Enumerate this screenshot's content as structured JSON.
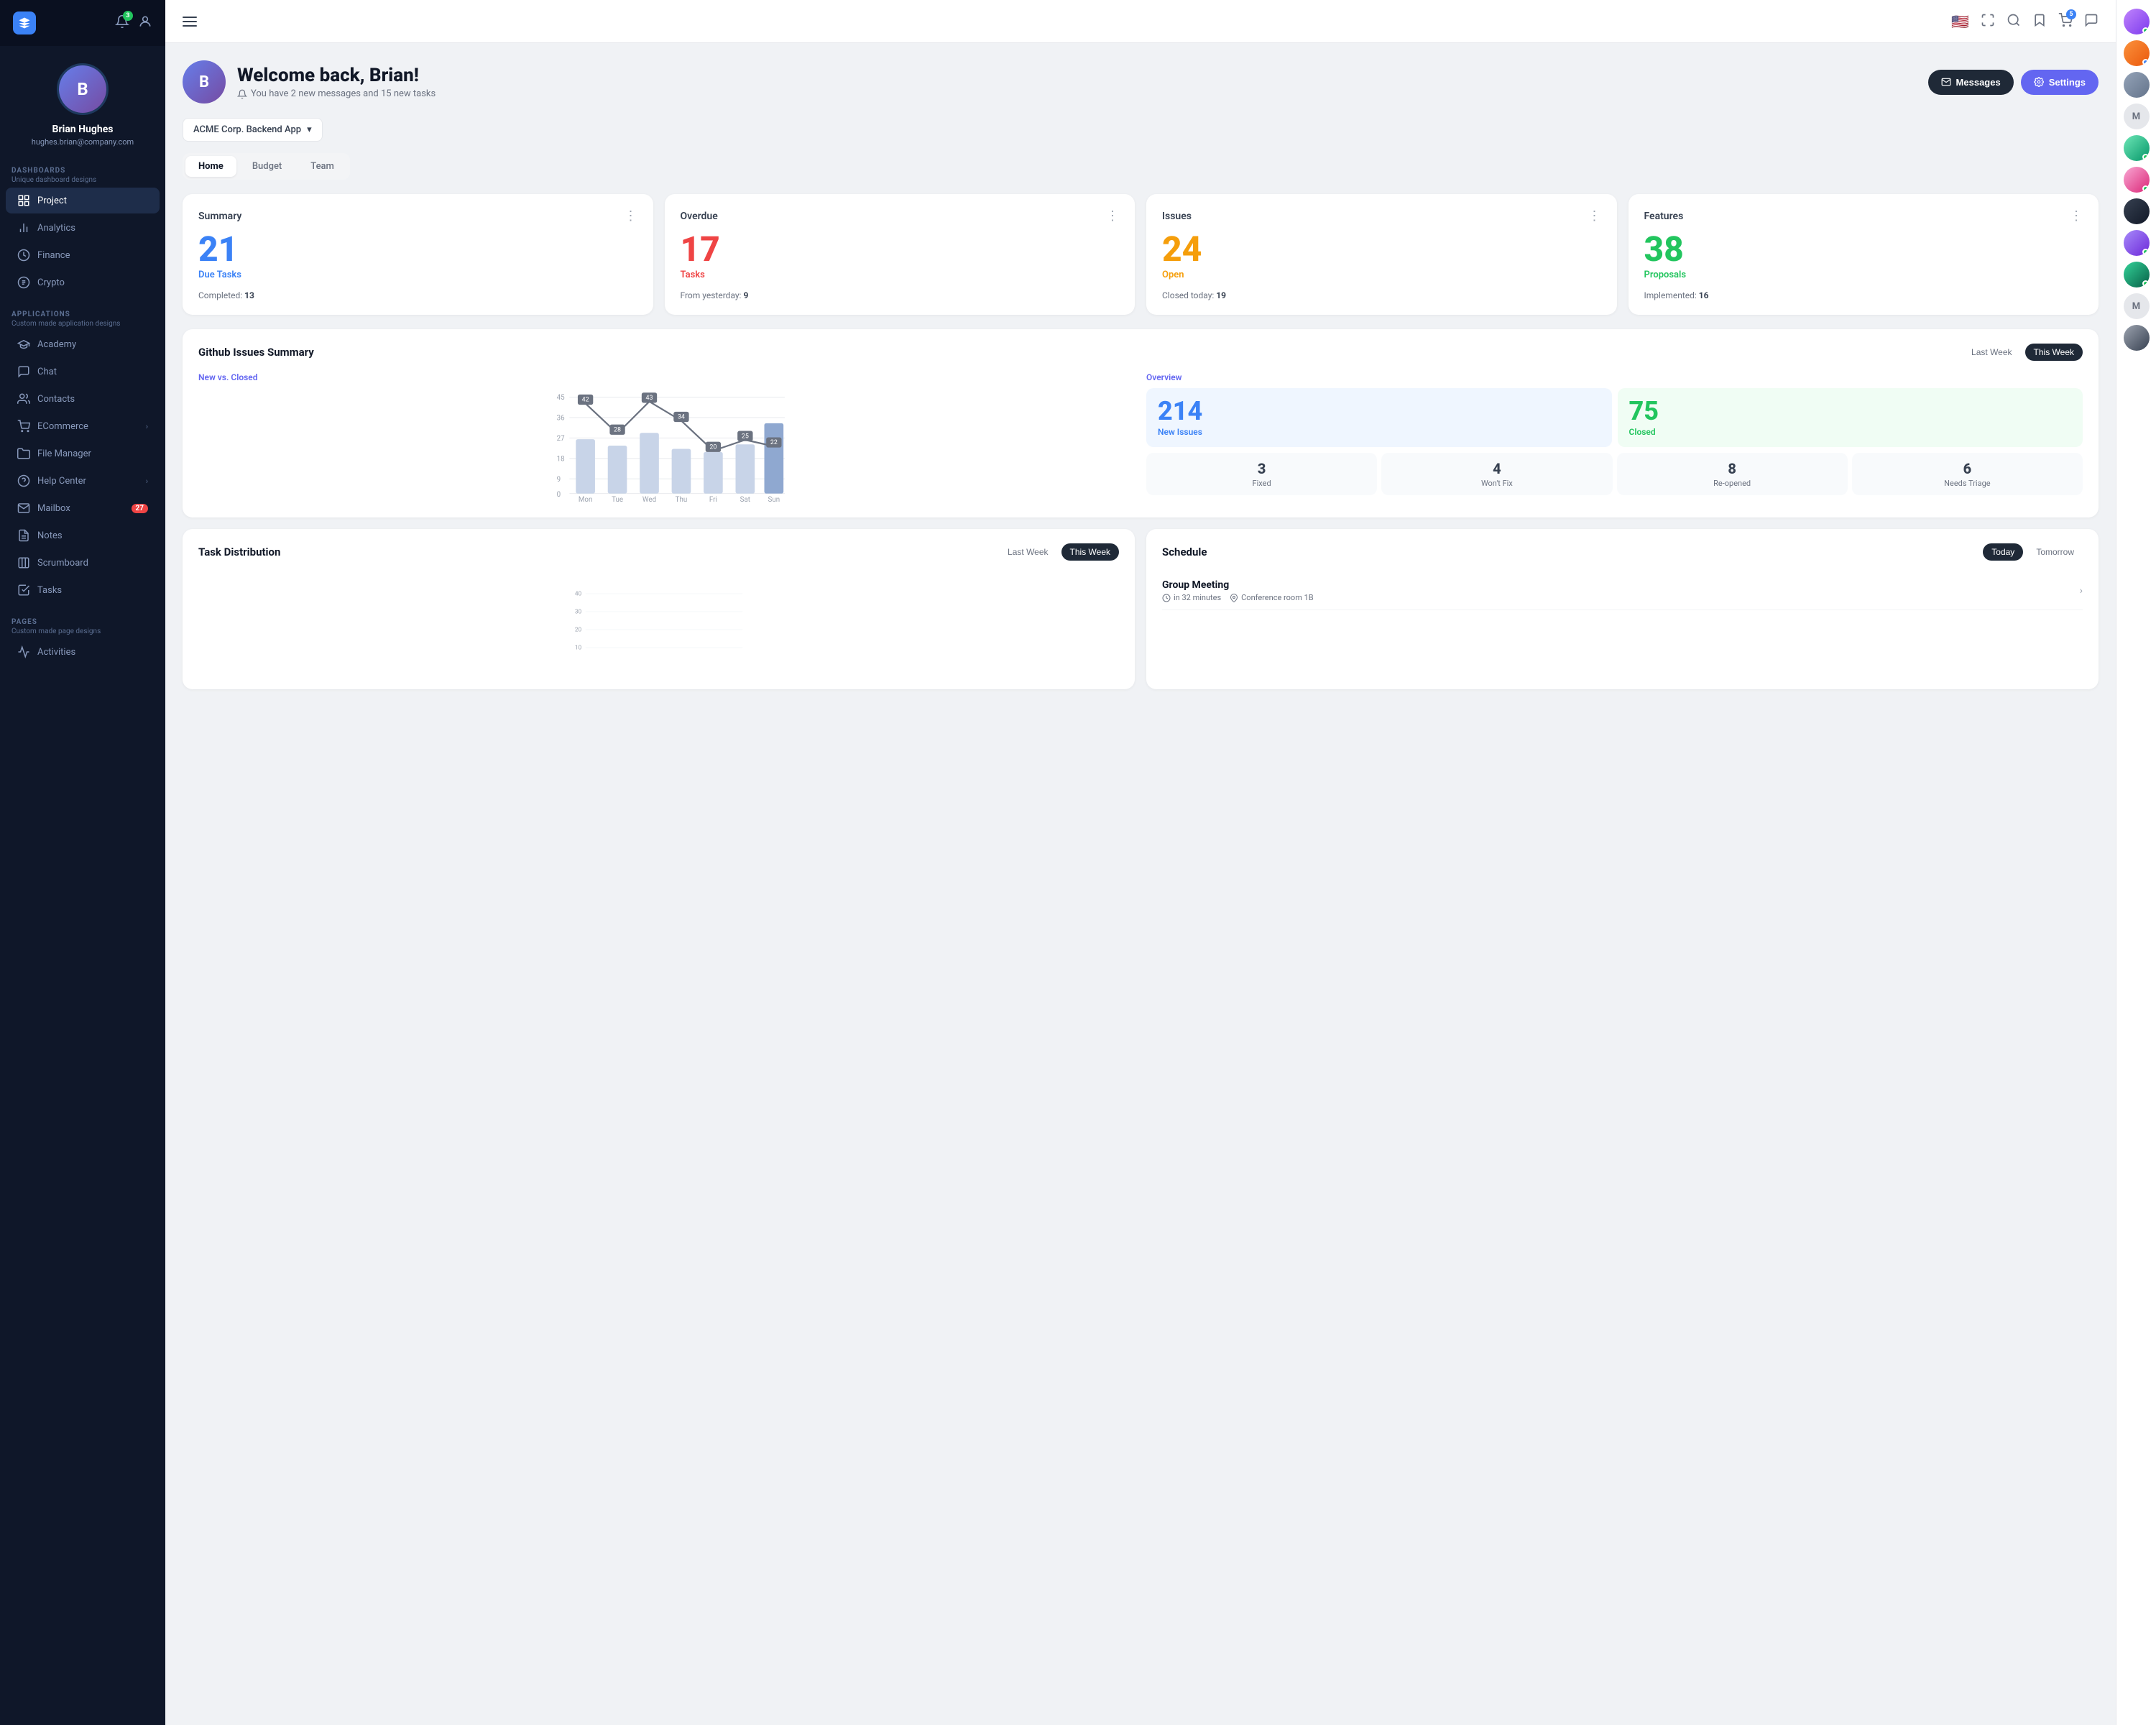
{
  "sidebar": {
    "logo": "◆",
    "notif_count": "3",
    "user": {
      "name": "Brian Hughes",
      "email": "hughes.brian@company.com"
    },
    "dashboards_label": "DASHBOARDS",
    "dashboards_sub": "Unique dashboard designs",
    "dashboards_items": [
      {
        "id": "project",
        "label": "Project",
        "icon": "grid",
        "active": true
      },
      {
        "id": "analytics",
        "label": "Analytics",
        "icon": "chart"
      },
      {
        "id": "finance",
        "label": "Finance",
        "icon": "finance"
      },
      {
        "id": "crypto",
        "label": "Crypto",
        "icon": "crypto"
      }
    ],
    "applications_label": "APPLICATIONS",
    "applications_sub": "Custom made application designs",
    "applications_items": [
      {
        "id": "academy",
        "label": "Academy",
        "icon": "academy"
      },
      {
        "id": "chat",
        "label": "Chat",
        "icon": "chat"
      },
      {
        "id": "contacts",
        "label": "Contacts",
        "icon": "contacts"
      },
      {
        "id": "ecommerce",
        "label": "ECommerce",
        "icon": "ecommerce",
        "arrow": "›"
      },
      {
        "id": "filemanager",
        "label": "File Manager",
        "icon": "file"
      },
      {
        "id": "helpcenter",
        "label": "Help Center",
        "icon": "help",
        "arrow": "›"
      },
      {
        "id": "mailbox",
        "label": "Mailbox",
        "icon": "mail",
        "badge": "27"
      },
      {
        "id": "notes",
        "label": "Notes",
        "icon": "notes"
      },
      {
        "id": "scrumboard",
        "label": "Scrumboard",
        "icon": "scrum"
      },
      {
        "id": "tasks",
        "label": "Tasks",
        "icon": "tasks"
      }
    ],
    "pages_label": "PAGES",
    "pages_sub": "Custom made page designs",
    "pages_items": [
      {
        "id": "activities",
        "label": "Activities",
        "icon": "activity"
      }
    ]
  },
  "topbar": {
    "menu_icon": "☰",
    "flag": "🇺🇸",
    "fullscreen_icon": "⛶",
    "search_icon": "🔍",
    "bookmark_icon": "🔖",
    "cart_icon": "🛒",
    "cart_badge": "5",
    "messages_icon": "💬"
  },
  "welcome": {
    "greeting": "Welcome back, Brian!",
    "subtitle": "You have 2 new messages and 15 new tasks",
    "messages_btn": "Messages",
    "settings_btn": "Settings"
  },
  "project_selector": {
    "label": "ACME Corp. Backend App",
    "arrow": "▾"
  },
  "tabs": [
    {
      "id": "home",
      "label": "Home",
      "active": true
    },
    {
      "id": "budget",
      "label": "Budget",
      "active": false
    },
    {
      "id": "team",
      "label": "Team",
      "active": false
    }
  ],
  "stats": [
    {
      "id": "summary",
      "title": "Summary",
      "number": "21",
      "label": "Due Tasks",
      "color": "blue",
      "footer_key": "Completed:",
      "footer_val": "13"
    },
    {
      "id": "overdue",
      "title": "Overdue",
      "number": "17",
      "label": "Tasks",
      "color": "red",
      "footer_key": "From yesterday:",
      "footer_val": "9"
    },
    {
      "id": "issues",
      "title": "Issues",
      "number": "24",
      "label": "Open",
      "color": "orange",
      "footer_key": "Closed today:",
      "footer_val": "19"
    },
    {
      "id": "features",
      "title": "Features",
      "number": "38",
      "label": "Proposals",
      "color": "green",
      "footer_key": "Implemented:",
      "footer_val": "16"
    }
  ],
  "github_issues": {
    "title": "Github Issues Summary",
    "last_week_btn": "Last Week",
    "this_week_btn": "This Week",
    "chart_subtitle": "New vs. Closed",
    "chart_data": {
      "days": [
        "Mon",
        "Tue",
        "Wed",
        "Thu",
        "Fri",
        "Sat",
        "Sun"
      ],
      "line_values": [
        42,
        28,
        43,
        34,
        20,
        25,
        22
      ],
      "bar_values": [
        35,
        30,
        38,
        28,
        22,
        30,
        42
      ]
    },
    "overview_subtitle": "Overview",
    "new_issues_num": "214",
    "new_issues_label": "New Issues",
    "closed_num": "75",
    "closed_label": "Closed",
    "small_cards": [
      {
        "num": "3",
        "label": "Fixed"
      },
      {
        "num": "4",
        "label": "Won't Fix"
      },
      {
        "num": "8",
        "label": "Re-opened"
      },
      {
        "num": "6",
        "label": "Needs Triage"
      }
    ]
  },
  "task_distribution": {
    "title": "Task Distribution",
    "last_week_btn": "Last Week",
    "this_week_btn": "This Week"
  },
  "schedule": {
    "title": "Schedule",
    "today_btn": "Today",
    "tomorrow_btn": "Tomorrow",
    "items": [
      {
        "title": "Group Meeting",
        "time": "in 32 minutes",
        "location": "Conference room 1B"
      }
    ]
  },
  "right_panel": {
    "avatars": [
      {
        "id": "a1",
        "online": true,
        "color": "#c084fc"
      },
      {
        "id": "a2",
        "online": true,
        "color": "#fb923c",
        "dot_color": "blue"
      },
      {
        "id": "a3",
        "online": false,
        "color": "#6b7280"
      },
      {
        "id": "a4",
        "label": "M",
        "is_initial": true
      },
      {
        "id": "a5",
        "online": true,
        "color": "#4ade80"
      },
      {
        "id": "a6",
        "online": true,
        "color": "#f472b6"
      },
      {
        "id": "a7",
        "online": false,
        "color": "#374151"
      },
      {
        "id": "a8",
        "online": true,
        "color": "#a78bfa"
      },
      {
        "id": "a9",
        "online": true,
        "color": "#34d399"
      },
      {
        "id": "a10",
        "label": "M",
        "is_initial": true
      },
      {
        "id": "a11",
        "online": false,
        "color": "#6b7280"
      }
    ]
  }
}
